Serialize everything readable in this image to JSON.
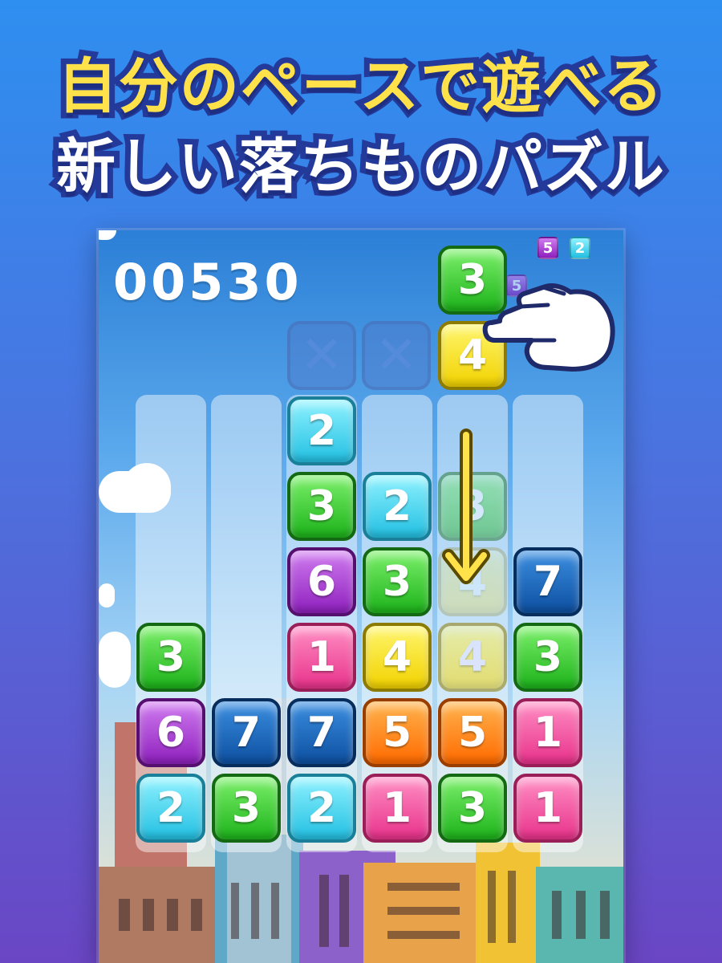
{
  "headline": {
    "line1": "自分のペースで遊べる",
    "line2": "新しい落ちものパズル"
  },
  "game": {
    "score": "00530",
    "next_preview": [
      "5",
      "2"
    ],
    "next_hidden": "5",
    "falling": [
      "3",
      "4"
    ],
    "blocked_symbol": "✕",
    "grid_columns": [
      [
        "3",
        "6",
        "2"
      ],
      [
        "7",
        "3"
      ],
      [
        "2",
        "3",
        "6",
        "1",
        "7",
        "2"
      ],
      [
        "2",
        "3",
        "4",
        "5",
        "1"
      ],
      [
        "4",
        "5",
        "3"
      ],
      [
        "7",
        "3",
        "1",
        "1"
      ]
    ],
    "ghost_tiles": [
      "3",
      "4"
    ],
    "landing_tile": "4"
  },
  "colors": {
    "1": "#e8318a",
    "2": "#22bfe2",
    "3": "#1cb21a",
    "4": "#f1d200",
    "5": "#ff6a00",
    "6": "#8e1fbd",
    "7": "#0d4fa0",
    "headline_yellow": "#ffe14a",
    "headline_outline": "#243a9a"
  },
  "icons": [
    "pointing-hand-icon",
    "down-arrow-icon",
    "x-mark-icon"
  ]
}
